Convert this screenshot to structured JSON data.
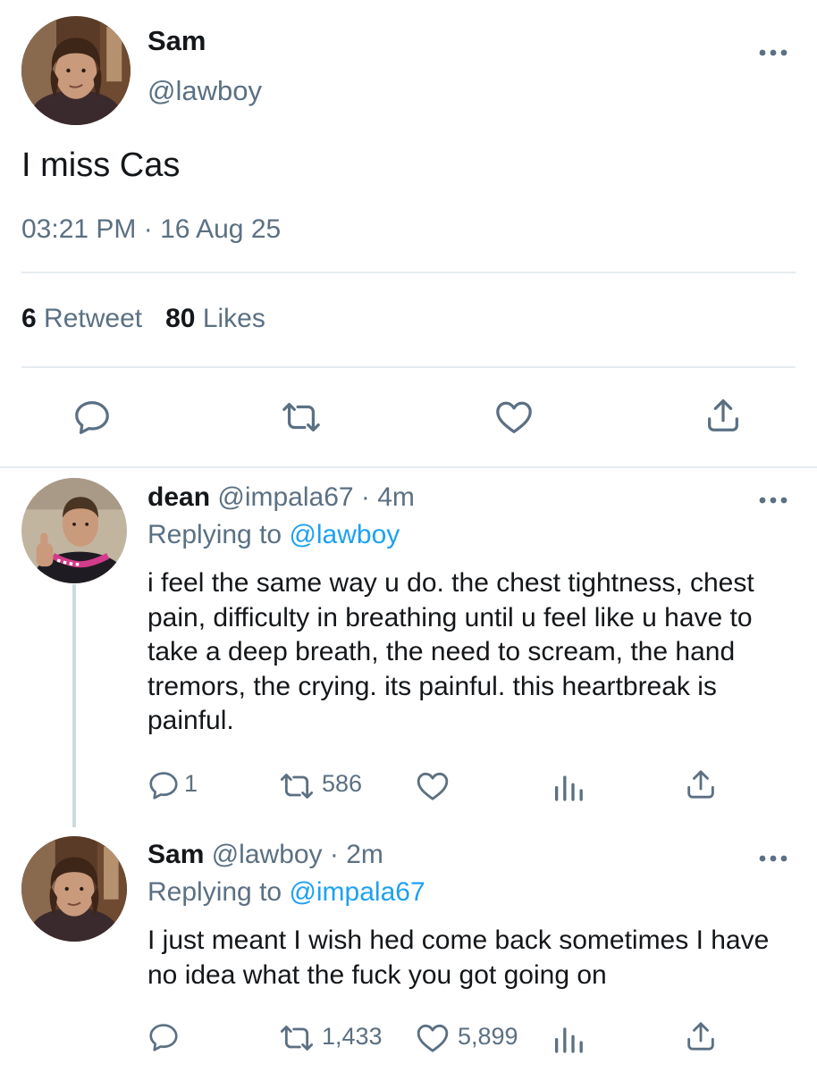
{
  "main_tweet": {
    "author_name": "Sam",
    "author_handle": "@lawboy",
    "text": "I miss Cas",
    "timestamp": "03:21 PM · 16 Aug 25",
    "retweet_count": "6",
    "retweet_label": "Retweet",
    "like_count": "80",
    "like_label": "Likes"
  },
  "replies": [
    {
      "name": "dean",
      "handle": "@impala67",
      "time": "· 4m",
      "replying_prefix": "Replying to",
      "replying_to": "@lawboy",
      "text": "i feel the same way u do. the chest tightness, chest pain, difficulty in breathing until u feel like u have to take a deep breath, the need to scream, the hand tremors, the crying. its painful. this heartbreak is painful.",
      "reply_count": "1",
      "retweet_count": "586",
      "like_count": ""
    },
    {
      "name": "Sam",
      "handle": "@lawboy",
      "time": "· 2m",
      "replying_prefix": "Replying to",
      "replying_to": "@impala67",
      "text": "I just meant I wish hed come back sometimes I have no idea what the fuck you got going on",
      "reply_count": "",
      "retweet_count": "1,433",
      "like_count": "5,899"
    }
  ],
  "colors": {
    "text_primary": "#14171a",
    "text_secondary": "#5b7083",
    "link": "#1da1f2",
    "divider": "#e6ecf0"
  },
  "icons": [
    "more-icon",
    "reply-icon",
    "retweet-icon",
    "like-icon",
    "share-icon",
    "analytics-icon"
  ]
}
